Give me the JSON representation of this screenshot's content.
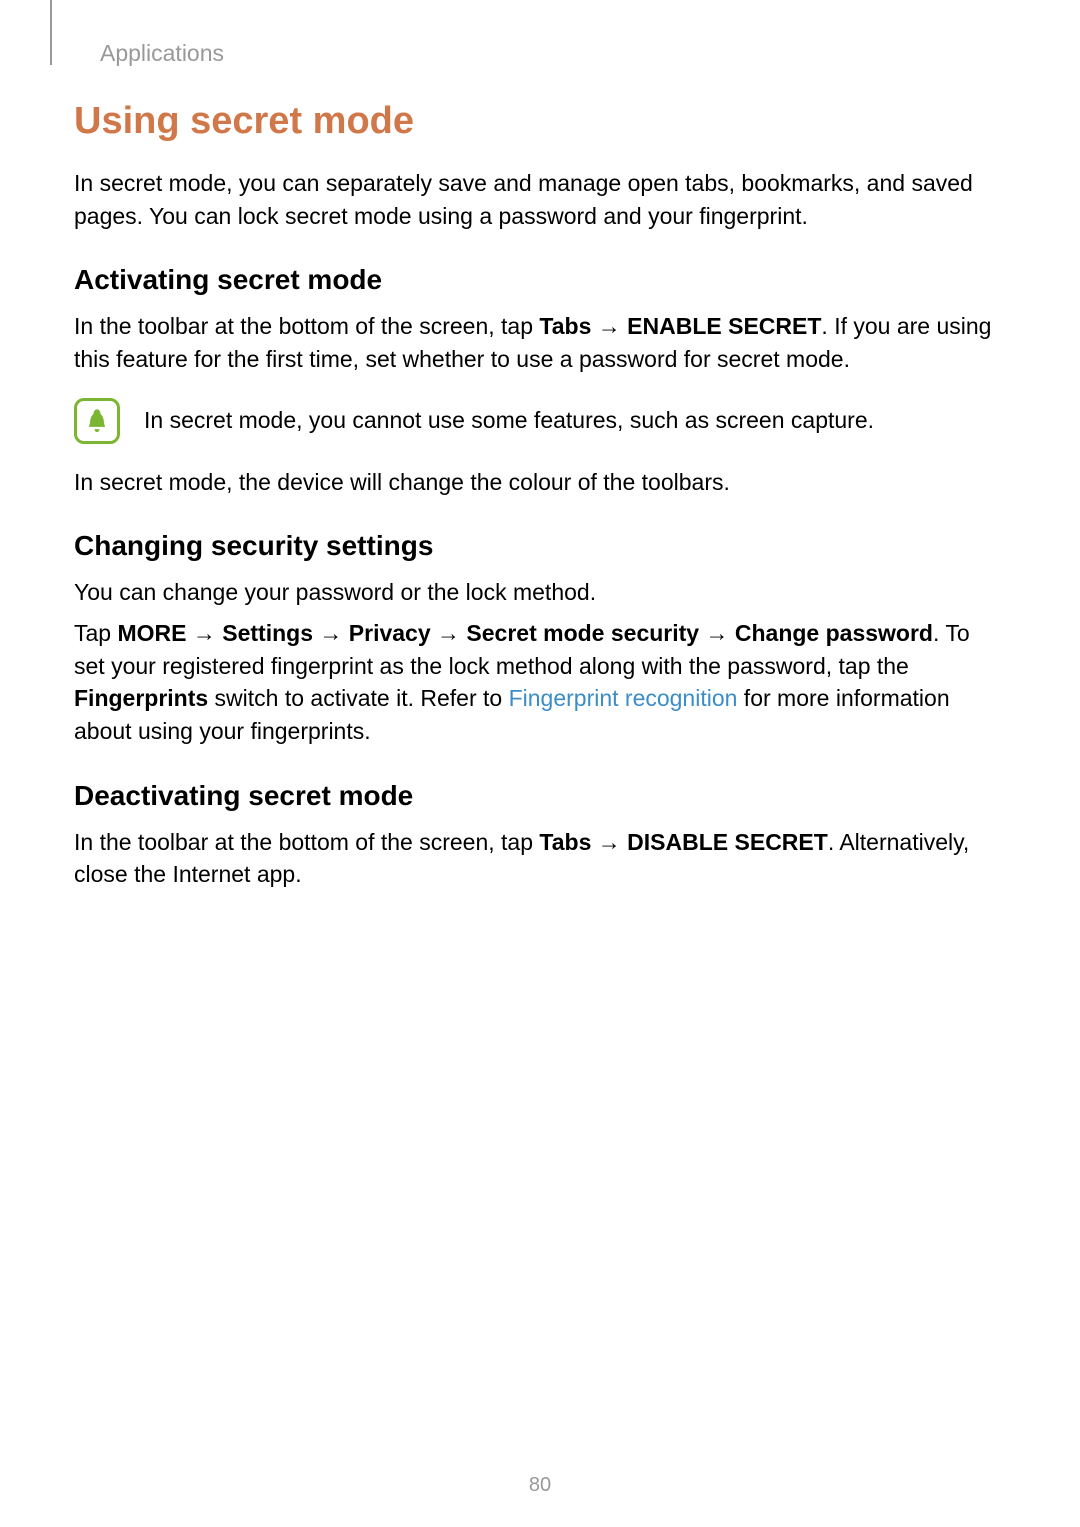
{
  "header": {
    "breadcrumb": "Applications"
  },
  "title": "Using secret mode",
  "intro": "In secret mode, you can separately save and manage open tabs, bookmarks, and saved pages. You can lock secret mode using a password and your fingerprint.",
  "section1": {
    "heading": "Activating secret mode",
    "p1_prefix": "In the toolbar at the bottom of the screen, tap ",
    "p1_bold1": "Tabs",
    "p1_arrow": " → ",
    "p1_bold2": "ENABLE SECRET",
    "p1_suffix": ". If you are using this feature for the first time, set whether to use a password for secret mode.",
    "note": "In secret mode, you cannot use some features, such as screen capture.",
    "p2": "In secret mode, the device will change the colour of the toolbars."
  },
  "section2": {
    "heading": "Changing security settings",
    "p1": "You can change your password or the lock method.",
    "p2_prefix": "Tap ",
    "p2_bold1": "MORE",
    "arrow": " → ",
    "p2_bold2": "Settings",
    "p2_bold3": "Privacy",
    "p2_bold4": "Secret mode security",
    "p2_bold5": "Change password",
    "p2_mid1": ". To set your registered fingerprint as the lock method along with the password, tap the ",
    "p2_bold6": "Fingerprints",
    "p2_mid2": " switch to activate it. Refer to ",
    "p2_link": "Fingerprint recognition",
    "p2_suffix": " for more information about using your fingerprints."
  },
  "section3": {
    "heading": "Deactivating secret mode",
    "p1_prefix": "In the toolbar at the bottom of the screen, tap ",
    "p1_bold1": "Tabs",
    "p1_arrow": " → ",
    "p1_bold2": "DISABLE SECRET",
    "p1_suffix": ". Alternatively, close the Internet app."
  },
  "page_number": "80"
}
